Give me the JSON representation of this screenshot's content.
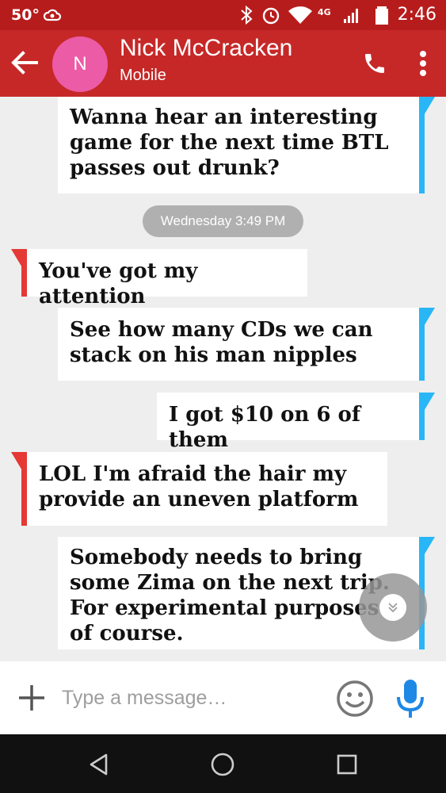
{
  "status_bar": {
    "temperature": "50°",
    "network": "4G",
    "time": "2:46"
  },
  "header": {
    "avatar_initial": "N",
    "contact_name": "Nick McCracken",
    "contact_subtitle": "Mobile",
    "accent_color": "#c62828"
  },
  "conversation": {
    "date_divider": "Wednesday 3:49 PM",
    "messages": [
      {
        "direction": "outgoing",
        "text": "Wanna hear an interesting game for the next time BTL passes out drunk?"
      },
      {
        "direction": "incoming",
        "text": "You've got my attention"
      },
      {
        "direction": "outgoing",
        "text": "See how many CDs we can stack on his man nipples"
      },
      {
        "direction": "outgoing",
        "text": "I got $10 on 6 of them"
      },
      {
        "direction": "incoming",
        "text": "LOL I'm afraid the hair my provide an uneven platform"
      },
      {
        "direction": "outgoing",
        "text": "Somebody needs to bring some Zima on the next trip. For experimental purposes of course."
      }
    ],
    "outgoing_color": "#29b6f6",
    "incoming_color": "#e53935"
  },
  "compose": {
    "placeholder": "Type a message…"
  },
  "icons": {
    "back": "back-arrow-icon",
    "call": "phone-icon",
    "more": "more-vert-icon",
    "add": "plus-icon",
    "emoji": "emoji-icon",
    "mic": "microphone-icon",
    "scroll": "chevron-double-down-icon"
  }
}
